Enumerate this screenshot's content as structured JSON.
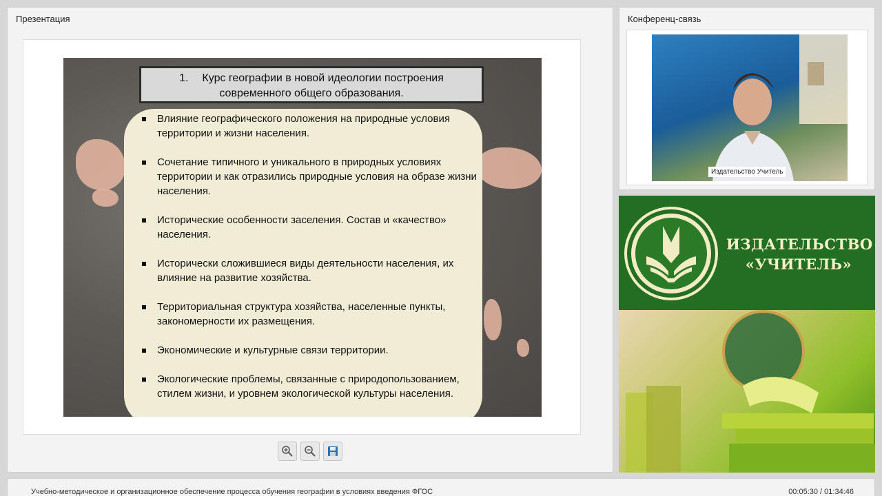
{
  "presentation": {
    "title": "Презентация",
    "slide": {
      "title_number": "1.",
      "title_line1": "Курс географии в новой идеологии построения",
      "title_line2": "современного общего образования.",
      "bullets": [
        "Влияние географического положения на природные условия территории и жизни населения.",
        "Сочетание типичного и уникального в природных условиях территории и как отразились природные условия на образе жизни населения.",
        "Исторические особенности заселения. Состав и «качество» населения.",
        "Исторически сложившиеся виды деятельности населения, их влияние на развитие хозяйства.",
        "Территориальная структура хозяйства, населенные пункты, закономерности их размещения.",
        "Экономические и культурные связи территории.",
        "Экологические проблемы, связанные с природопользованием, стилем жизни, и уровнем экологической культуры населения."
      ]
    },
    "toolbar": {
      "zoom_in_icon": "zoom-in-icon",
      "zoom_out_icon": "zoom-out-icon",
      "save_icon": "save-icon"
    }
  },
  "conference": {
    "title": "Конференц-связь",
    "speaker_label": "Издательство Учитель"
  },
  "publisher": {
    "name_line1": "ИЗДАТЕЛЬСТВО",
    "name_line2": "«УЧИТЕЛЬ»",
    "brand_color": "#226e22"
  },
  "footer": {
    "lecture_title": "Учебно-методическое и организационное обеспечение процесса обучения географии в условиях введения ФГОС",
    "time": "00:05:30 / 01:34:46"
  }
}
